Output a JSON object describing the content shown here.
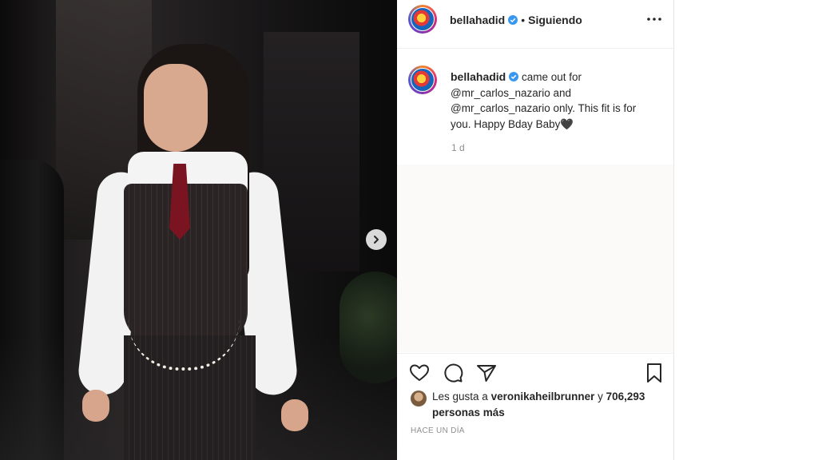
{
  "post": {
    "username": "bellahadid",
    "follow_status": "Siguiendo",
    "separator": "•",
    "more_icon": "more-horizontal-icon"
  },
  "caption": {
    "username": "bellahadid",
    "text_part1": " came out for ",
    "mention1": "@mr_carlos_nazario",
    "text_part2": " and ",
    "mention2": "@mr_carlos_nazario",
    "text_part3": " only. This fit is for you. Happy Bday Baby",
    "emoji": "🖤",
    "time": "1 d"
  },
  "likes": {
    "prefix": "Les gusta a ",
    "user": "veronikaheilbrunner",
    "middle": " y ",
    "count": "706,293 personas más"
  },
  "timestamp": "HACE UN DÍA",
  "colors": {
    "text": "#262626",
    "muted": "#8e8e8e",
    "verified": "#3897f0"
  }
}
